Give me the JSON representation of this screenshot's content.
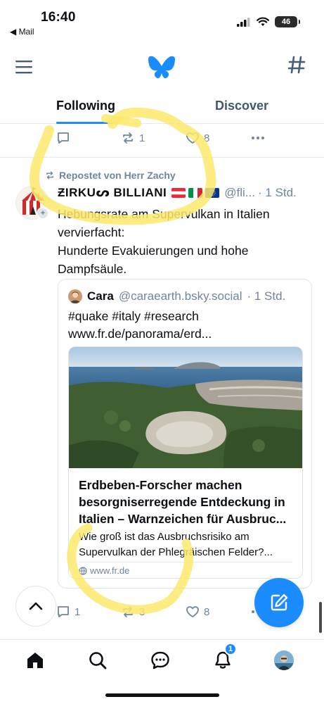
{
  "status_bar": {
    "time": "16:40",
    "back_app": "◀ Mail",
    "battery": "46"
  },
  "feed_tabs": {
    "following": "Following",
    "discover": "Discover"
  },
  "first_post_actions": {
    "reposts": "1",
    "likes": "8"
  },
  "repost_info": {
    "label": "Repostet von Herr Zachy"
  },
  "post": {
    "author_name": "ƵIRKUᔕ BILLIANI",
    "handle": "@fli...",
    "time": "· 1 Std.",
    "text_line1": "Hebungsrate am Supervulkan in Italien",
    "text_line2": "vervierfacht:",
    "text_line3": "Hunderte Evakuierungen und hohe",
    "text_line4": "Dampfsäule."
  },
  "quote": {
    "author_name": "Cara",
    "handle": "@caraearth.bsky.social",
    "time": "· 1 Std.",
    "text_line1": "#quake #italy #research",
    "text_line2": "www.fr.de/panorama/erd..."
  },
  "link_card": {
    "title": "Erdbeben-Forscher machen besorgniserregende Entdeckung in Italien – Warnzeichen für Ausbruc...",
    "description": "Wie groß ist das Ausbruchsrisiko am Supervulkan der Phlegräischen Felder?...",
    "domain": "www.fr.de"
  },
  "post_actions": {
    "replies": "1",
    "reposts": "3",
    "likes": "8"
  },
  "notifications": {
    "badge_count": "1"
  },
  "colors": {
    "accent": "#1a8cff",
    "muted": "#6f869f",
    "highlight": "#fbe96b"
  }
}
